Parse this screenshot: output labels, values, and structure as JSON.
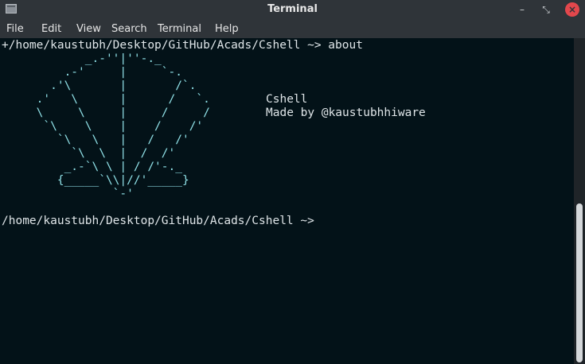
{
  "window": {
    "title": "Terminal",
    "minimize_glyph": "–",
    "maximize_glyph": "⤡",
    "close_glyph": "×"
  },
  "menu": {
    "items": [
      "File",
      "Edit",
      "View",
      "Search",
      "Terminal",
      "Help"
    ]
  },
  "terminal": {
    "command_line": "+/home/kaustubh/Desktop/GitHub/Acads/Cshell ~> about",
    "ascii_art": "            _.-''|''-._\n         .-'     |     `-.\n       .'\\       |       /`.\n     .'   \\      |      /   `.\n     \\     \\     |     /     /\n      `\\    \\    |    /    /'\n        `\\   \\   |   /   /'\n          `\\  \\  |  /  /'\n         _.-`\\ \\ | / /'-._\n        {_____`\\\\|//'_____}\n                `-'",
    "info_title": "Cshell",
    "info_author": "Made by @kaustubhhiware",
    "prompt_line": "/home/kaustubh/Desktop/GitHub/Acads/Cshell ~>"
  },
  "colors": {
    "terminal_bg": "#031218",
    "art_color": "#8fe0e6",
    "text_color": "#dfe5e8",
    "titlebar_bg": "#2f3439",
    "close_button": "#e2474c"
  }
}
